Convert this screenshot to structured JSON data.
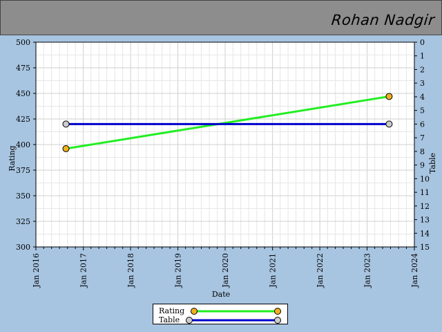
{
  "header": {
    "name": "Rohan Nadgir"
  },
  "legend": {
    "items": [
      {
        "label": "Rating",
        "color": "#22ee22",
        "marker_color": "#f2b01e"
      },
      {
        "label": "Table",
        "color": "#0000cc",
        "marker_color": "#cccccc"
      }
    ]
  },
  "chart_data": {
    "type": "line",
    "title": "",
    "xlabel": "Date",
    "ylabel": "Rating",
    "y2label": "Table",
    "x_ticks": [
      "Jan 2016",
      "Jan 2017",
      "Jan 2018",
      "Jan 2019",
      "Jan 2020",
      "Jan 2021",
      "Jan 2022",
      "Jan 2023",
      "Jan 2024"
    ],
    "xlim": [
      "2016-01-01",
      "2024-01-01"
    ],
    "ylim": [
      300,
      500
    ],
    "y_ticks": [
      300,
      325,
      350,
      375,
      400,
      425,
      450,
      475,
      500
    ],
    "y2lim": [
      15,
      0
    ],
    "y2_ticks": [
      0,
      1,
      2,
      3,
      4,
      5,
      6,
      7,
      8,
      9,
      10,
      11,
      12,
      13,
      14,
      15
    ],
    "y2_reversed": true,
    "grid": true,
    "legend_position": "bottom",
    "series": [
      {
        "name": "Rating",
        "axis": "left",
        "color": "#22ee22",
        "marker_color": "#f2b01e",
        "points": [
          {
            "x": "2016-08-20",
            "y": 396
          },
          {
            "x": "2023-06-20",
            "y": 447
          }
        ]
      },
      {
        "name": "Table",
        "axis": "right",
        "color": "#0000cc",
        "marker_color": "#cccccc",
        "points": [
          {
            "x": "2016-08-20",
            "y": 6
          },
          {
            "x": "2023-06-20",
            "y": 6
          }
        ]
      }
    ]
  }
}
